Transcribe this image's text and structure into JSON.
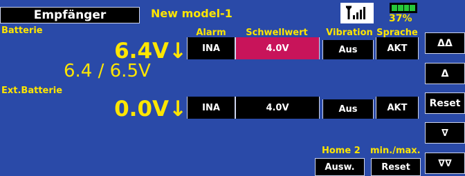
{
  "header": {
    "title": "Empfänger",
    "model": "New model-1",
    "battery_percent": "37%"
  },
  "columns": {
    "alarm": "Alarm",
    "threshold": "Schwellwert",
    "vibration": "Vibration",
    "language": "Sprache"
  },
  "battery": {
    "label": "Batterie",
    "voltage": "6.4V",
    "arrow": "↓",
    "sub": "6.4 / 6.5V",
    "alarm": "INA",
    "threshold": "4.0V",
    "vibration": "Aus",
    "language": "AKT"
  },
  "ext_battery": {
    "label": "Ext.Batterie",
    "voltage": "0.0V",
    "arrow": "↓",
    "alarm": "INA",
    "threshold": "4.0V",
    "vibration": "Aus",
    "language": "AKT"
  },
  "bottom": {
    "home_label": "Home 2",
    "home_button": "Ausw.",
    "minmax_label": "min./max.",
    "minmax_button": "Reset"
  },
  "side": {
    "up_up": "ΔΔ",
    "up": "Δ",
    "reset": "Reset",
    "down": "∇",
    "down_down": "∇∇"
  },
  "colors": {
    "background": "#2a4aa8",
    "accent_text": "#ffe600",
    "highlight": "#c8145a",
    "battery_fill": "#26c83a"
  },
  "icons": {
    "signal": "signal-antenna-icon",
    "battery": "battery-icon"
  }
}
